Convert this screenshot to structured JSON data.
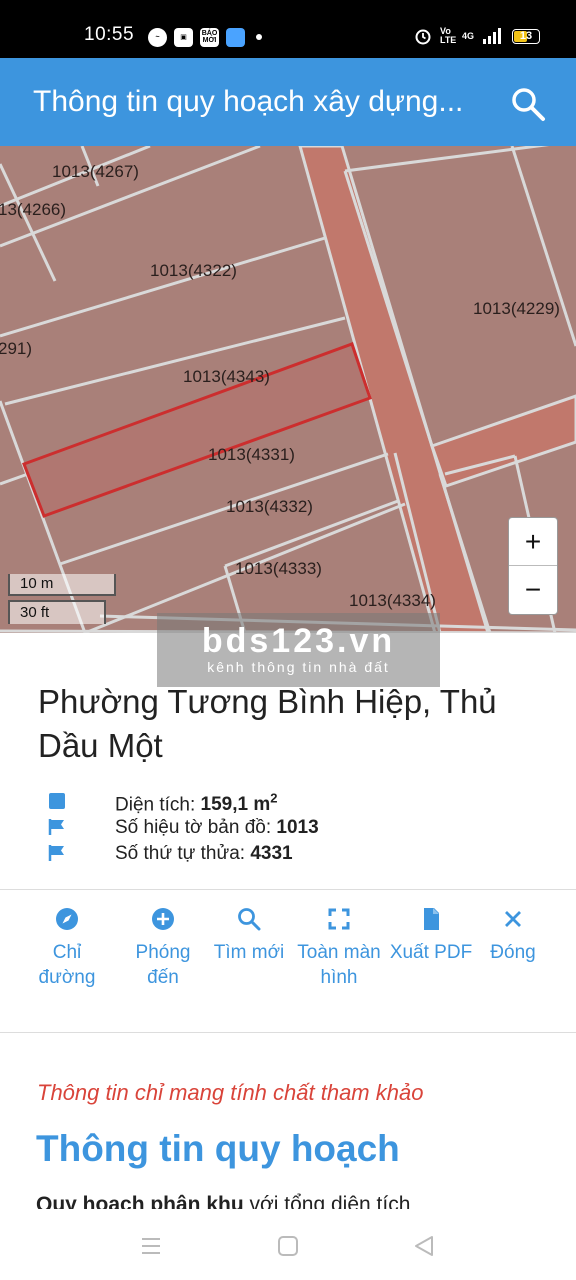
{
  "status_bar": {
    "time": "10:55",
    "battery": "13",
    "network": "4G",
    "volte": "Vo LTE",
    "notif_bao": "BÁO MỚI"
  },
  "app_bar": {
    "title": "Thông tin quy hoạch xây dựng",
    "search_icon": "search-icon"
  },
  "map": {
    "parcels": [
      {
        "label": "1013(4267)"
      },
      {
        "label": "13(4266)"
      },
      {
        "label": "1013(4322)"
      },
      {
        "label": "1013(4229)"
      },
      {
        "label": "291)"
      },
      {
        "label": "1013(4343)"
      },
      {
        "label": "1013(4331)"
      },
      {
        "label": "1013(4332)"
      },
      {
        "label": "1013(4333)"
      },
      {
        "label": "1013(4334)"
      }
    ],
    "scale_m": "10 m",
    "scale_ft": "30 ft",
    "zoom_in": "+",
    "zoom_out": "−",
    "colors": {
      "parcel": "#a98079",
      "road": "#c1786c",
      "border": "#d9d9d9",
      "highlight": "#cc2e2e"
    }
  },
  "watermark": {
    "brand": "bds123.vn",
    "tagline": "kênh thông tin nhà đất"
  },
  "info": {
    "place": "Phường Tương Bình Hiệp, Thủ Dầu Một",
    "area_label": "Diện tích:",
    "area_value": "159,1 m",
    "area_unit_sup": "2",
    "sheet_label": "Số hiệu tờ bản đồ:",
    "sheet_value": "1013",
    "plot_label": "Số thứ tự thửa:",
    "plot_value": "4331"
  },
  "actions": [
    {
      "label": "Chỉ đường",
      "icon": "compass-icon"
    },
    {
      "label": "Phóng đến",
      "icon": "plus-circle-icon"
    },
    {
      "label": "Tìm mới",
      "icon": "search-icon"
    },
    {
      "label": "Toàn màn hình",
      "icon": "fullscreen-icon"
    },
    {
      "label": "Xuất PDF",
      "icon": "file-icon"
    },
    {
      "label": "Đóng",
      "icon": "close-icon"
    }
  ],
  "notes": {
    "disclaimer": "Thông tin chỉ mang tính chất tham khảo",
    "heading": "Thông tin quy hoạch",
    "para_bold": "Quy hoạch phân khu",
    "para_rest": " với tổng diện tích"
  },
  "nav": {
    "menu_icon": "menu-icon",
    "home_icon": "home-square-icon",
    "back_icon": "back-triangle-icon"
  },
  "accent": "#3d95de"
}
